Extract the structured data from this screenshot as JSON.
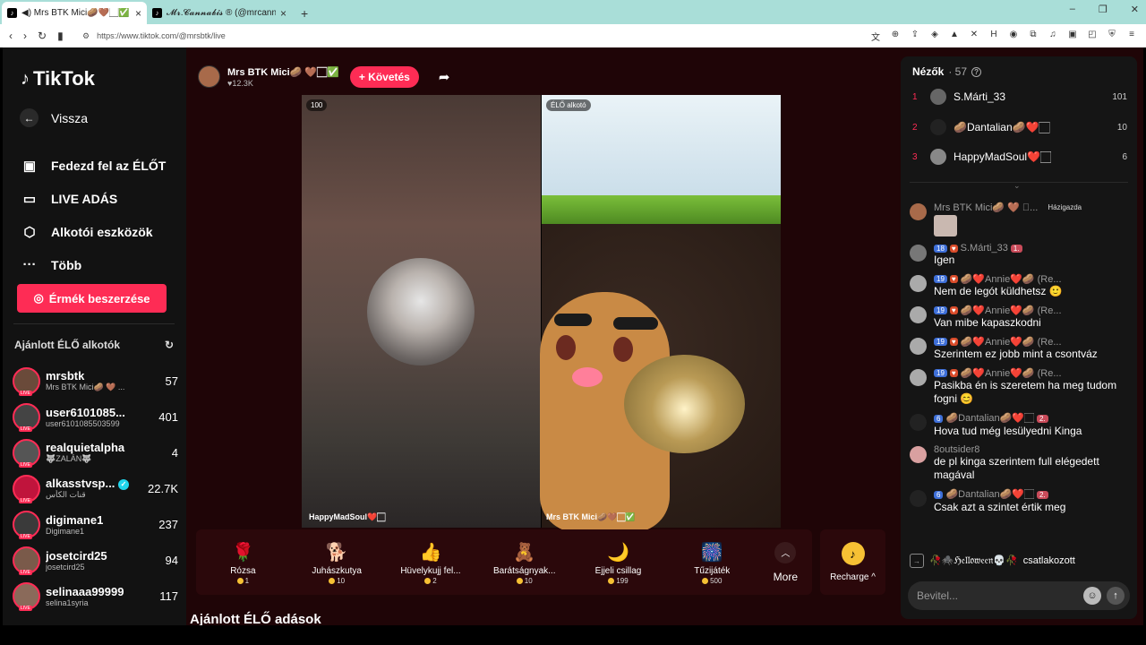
{
  "browser": {
    "tabs": [
      {
        "icon": "tiktok-icon",
        "title": "◀) Mrs BTK Mici🥔🤎🏻✅ (@m"
      },
      {
        "icon": "tiktok-icon",
        "title": "𝓜𝓻.𝓒𝓪𝓷𝓷𝓪𝓫𝓲𝓼 ® (@mrcannabis_)"
      }
    ],
    "url": "https://www.tiktok.com/@mrsbtk/live"
  },
  "sidebar": {
    "logo": "TikTok",
    "back_label": "Vissza",
    "menu": [
      {
        "icon": "explore-live-icon",
        "label": "Fedezd fel az ÉLŐT"
      },
      {
        "icon": "live-camera-icon",
        "label": "LIVE ADÁS"
      },
      {
        "icon": "creator-tools-icon",
        "label": "Alkotói eszközök"
      },
      {
        "icon": "more-icon",
        "label": "Több"
      }
    ],
    "coins_button": "Érmék beszerzése",
    "recommended_title": "Ajánlott ÉLŐ alkotók",
    "recommended": [
      {
        "name": "mrsbtk",
        "sub": "Mrs BTK Mici🥔 🤎 ...",
        "count": "57"
      },
      {
        "name": "user6101085...",
        "sub": "user6101085503599",
        "count": "401"
      },
      {
        "name": "realquietalpha",
        "sub": "🐺ZALÁN🐺",
        "count": "4"
      },
      {
        "name": "alkasstvsp...",
        "sub": "قنات الكأس",
        "count": "22.7K"
      },
      {
        "name": "digimane1",
        "sub": "Digimane1",
        "count": "237"
      },
      {
        "name": "josetcird25",
        "sub": "josetcird25",
        "count": "94"
      },
      {
        "name": "selinaaa99999",
        "sub": "selina1syria",
        "count": "117"
      }
    ]
  },
  "live": {
    "host_name": "Mrs BTK Mici🥔 🤎🏻✅",
    "likes": "♥12.3K",
    "follow": "+ Követés",
    "left_badge": "100",
    "right_badge": "ÉLŐ alkotó",
    "left_name": "HappyMadSoul❤️🏻",
    "right_name": "Mrs BTK Mici🥔🤎🏻✅"
  },
  "gifts": [
    {
      "icon": "🌹",
      "name": "Rózsa",
      "price": "1"
    },
    {
      "icon": "🐕",
      "name": "Juhászkutya",
      "price": "10"
    },
    {
      "icon": "👍",
      "name": "Hüvelykujj fel...",
      "price": "2"
    },
    {
      "icon": "🧸",
      "name": "Barátságnyak...",
      "price": "10"
    },
    {
      "icon": "🌙",
      "name": "Éjjeli csillag",
      "price": "199"
    },
    {
      "icon": "🎆",
      "name": "Tűzijáték",
      "price": "500"
    }
  ],
  "more_label": "More",
  "recharge_label": "Recharge",
  "recommended_live_heading": "Ajánlott ÉLŐ adások",
  "chat": {
    "viewers_label": "Nézők",
    "viewers_count": "· 57",
    "top_viewers": [
      {
        "rank": "1",
        "name": "S.Márti_33",
        "value": "101"
      },
      {
        "rank": "2",
        "name": "🥔Dantalian🥔❤️🏻",
        "value": "10"
      },
      {
        "rank": "3",
        "name": "HappyMadSoul❤️🏻",
        "value": "6"
      }
    ],
    "messages": [
      {
        "user": "Mrs BTK Mici🥔 🤎 🏻...",
        "tag": "Házigazda",
        "text": ""
      },
      {
        "user": "S.Márti_33",
        "lvl": "18",
        "text": "Igen"
      },
      {
        "user": "🥔❤️Annie❤️🥔 (Re...",
        "lvl": "19",
        "text": "Nem de legót küldhetsz 🙂"
      },
      {
        "user": "🥔❤️Annie❤️🥔 (Re...",
        "lvl": "19",
        "text": "Van mibe kapaszkodni"
      },
      {
        "user": "🥔❤️Annie❤️🥔 (Re...",
        "lvl": "19",
        "text": "Szerintem ez jobb mint a csontváz"
      },
      {
        "user": "🥔❤️Annie❤️🥔 (Re...",
        "lvl": "19",
        "text": "Pasikba én is szeretem ha meg tudom fogni 😊"
      },
      {
        "user": "🥔Dantalian🥔❤️🏻",
        "lvl": "6",
        "text": "Hova tud még lesülyedni Kinga"
      },
      {
        "user": "8outsider8",
        "text": "de pl kinga szerintem full elégedett magával"
      },
      {
        "user": "🥔Dantalian🥔❤️🏻",
        "lvl": "6",
        "text": "Csak azt a szintet értik meg"
      }
    ],
    "joined_user": "🥀🕷️ℌ𝔢𝔩𝔩𝔬𝔴𝔢𝔢𝔫💀🥀",
    "joined_text": "csatlakozott",
    "input_placeholder": "Bevitel..."
  }
}
